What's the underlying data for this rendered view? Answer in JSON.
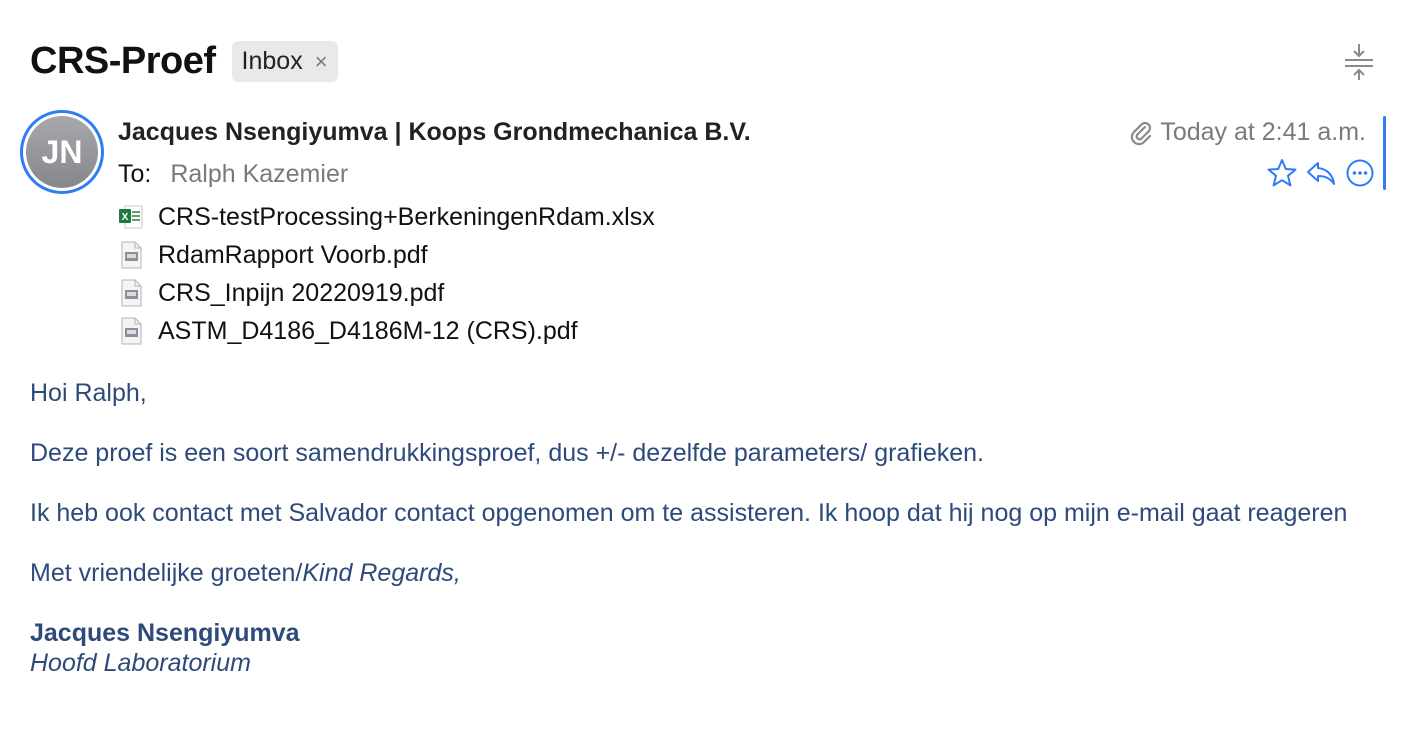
{
  "header": {
    "subject": "CRS-Proef",
    "mailbox_tag": "Inbox",
    "mailbox_tag_close": "×"
  },
  "message": {
    "avatar_initials": "JN",
    "sender": "Jacques Nsengiyumva | Koops Grondmechanica B.V.",
    "to_label": "To:",
    "to_value": "Ralph Kazemier",
    "date": "Today at 2:41 a.m.",
    "attachment_icon": "paperclip-icon",
    "actions": [
      "star-icon",
      "reply-icon",
      "more-icon"
    ]
  },
  "attachments": [
    {
      "name": "CRS-testProcessing+BerkeningenRdam.xlsx",
      "type": "xlsx"
    },
    {
      "name": "RdamRapport Voorb.pdf",
      "type": "pdf"
    },
    {
      "name": "CRS_Inpijn 20220919.pdf",
      "type": "pdf"
    },
    {
      "name": "ASTM_D4186_D4186M-12 (CRS).pdf",
      "type": "pdf"
    }
  ],
  "body": {
    "greeting": "Hoi Ralph,",
    "para1": "Deze proef is een soort samendrukkingsproef, dus +/- dezelfde parameters/ grafieken.",
    "para2": "Ik heb ook contact met Salvador contact opgenomen om te assisteren. Ik hoop dat hij nog op mijn e-mail gaat reageren",
    "closing_plain": "Met vriendelijke groeten/",
    "closing_italic": "Kind Regards,",
    "signature_name": "Jacques Nsengiyumva",
    "signature_role": "Hoofd Laboratorium"
  },
  "colors": {
    "accent": "#2f7cf6",
    "body_text": "#2d4a7a",
    "muted": "#7a7a7a"
  }
}
